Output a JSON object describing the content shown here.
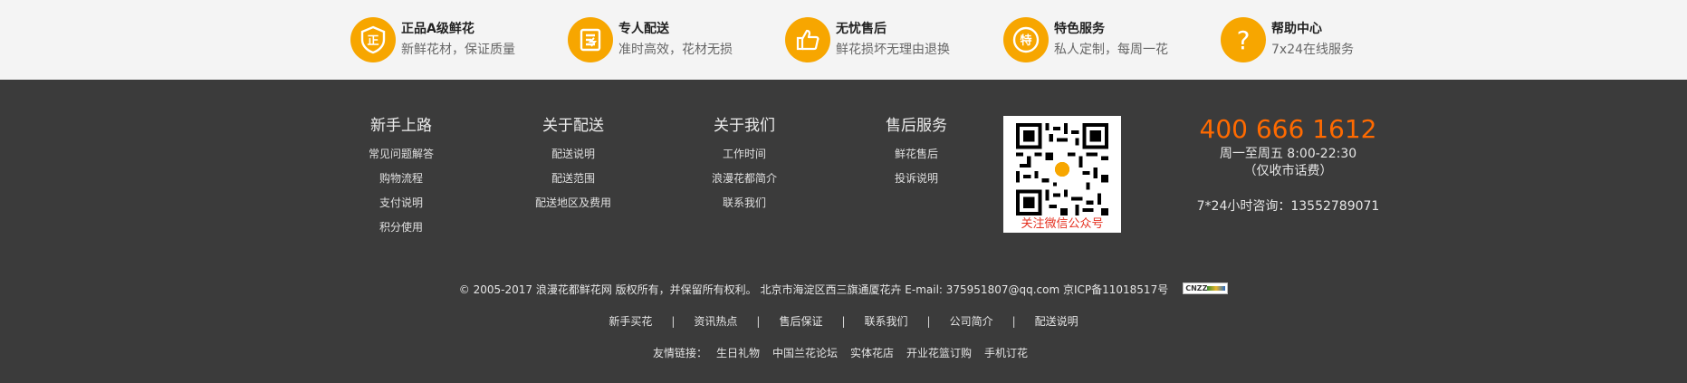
{
  "services": [
    {
      "title": "正品A级鲜花",
      "sub": "新鲜花材，保证质量",
      "icon": "zheng-badge-icon",
      "glyph": "正"
    },
    {
      "title": "专人配送",
      "sub": "准时高效，花材无损",
      "icon": "delivery-icon",
      "glyph": ""
    },
    {
      "title": "无忧售后",
      "sub": "鲜花损坏无理由退换",
      "icon": "thumbs-up-icon",
      "glyph": ""
    },
    {
      "title": "特色服务",
      "sub": "私人定制，每周一花",
      "icon": "te-badge-icon",
      "glyph": "特"
    },
    {
      "title": "帮助中心",
      "sub": "7x24在线服务",
      "icon": "question-icon",
      "glyph": "?"
    }
  ],
  "columns": [
    {
      "title": "新手上路",
      "links": [
        "常见问题解答",
        "购物流程",
        "支付说明",
        "积分使用"
      ]
    },
    {
      "title": "关于配送",
      "links": [
        "配送说明",
        "配送范围",
        "配送地区及费用"
      ]
    },
    {
      "title": "关于我们",
      "links": [
        "工作时间",
        "浪漫花都简介",
        "联系我们"
      ]
    },
    {
      "title": "售后服务",
      "links": [
        "鲜花售后",
        "投诉说明"
      ]
    }
  ],
  "qr": {
    "caption": "关注微信公众号"
  },
  "contact": {
    "phone": "400 666 1612",
    "hours": "周一至周五 8:00-22:30",
    "note": "（仅收市话费）",
    "consult": "7*24小时咨询：13552789071"
  },
  "copyright": "© 2005-2017 浪漫花都鲜花网 版权所有，并保留所有权利。 北京市海淀区西三旗通厦花卉 E-mail: 375951807@qq.com 京ICP备11018517号",
  "cnzz_label": "CNZZ",
  "bottom_links": [
    "新手买花",
    "资讯热点",
    "售后保证",
    "联系我们",
    "公司简介",
    "配送说明"
  ],
  "separator": "|",
  "friend": {
    "label": "友情链接：",
    "links": [
      "生日礼物",
      "中国兰花论坛",
      "实体花店",
      "开业花篮订购",
      "手机订花"
    ]
  },
  "colors": {
    "accent": "#f7a600",
    "phone": "#ff6a00",
    "footer_bg": "#3b3b3b",
    "qr_caption": "#e53322"
  }
}
